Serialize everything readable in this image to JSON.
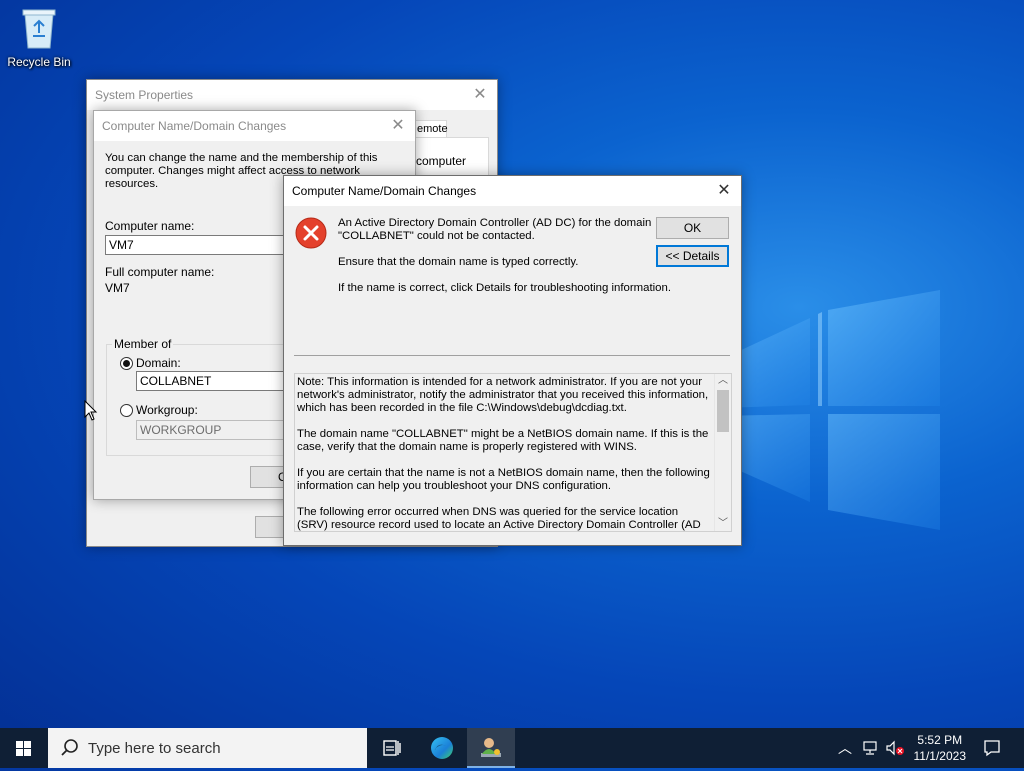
{
  "desktop": {
    "recycle_bin_label": "Recycle Bin"
  },
  "system_properties": {
    "title": "System Properties",
    "tab_remote_partial": "emote",
    "partial_text": "computer"
  },
  "name_changes": {
    "title": "Computer Name/Domain Changes",
    "description": "You can change the name and the membership of this computer. Changes might affect access to network resources.",
    "computer_name_label": "Computer name:",
    "computer_name_value": "VM7",
    "full_name_label": "Full computer name:",
    "full_name_value": "VM7",
    "member_of_label": "Member of",
    "domain_label": "Domain:",
    "domain_value": "COLLABNET",
    "workgroup_label": "Workgroup:",
    "workgroup_value": "WORKGROUP",
    "ok_partial": "O"
  },
  "error_dialog": {
    "title": "Computer Name/Domain Changes",
    "message_line1": "An Active Directory Domain Controller (AD DC) for the domain",
    "message_line2": "\"COLLABNET\" could not be contacted.",
    "message_ensure": "Ensure that the domain name is typed correctly.",
    "message_details": "If the name is correct, click Details for troubleshooting information.",
    "ok_label": "OK",
    "details_label": "<< Details",
    "details_paragraphs": [
      "Note: This information is intended for a network administrator.  If you are not your network's administrator, notify the administrator that you received this information, which has been recorded in the file C:\\Windows\\debug\\dcdiag.txt.",
      "The domain name \"COLLABNET\" might be a NetBIOS domain name.  If this is the case, verify that the domain name is properly registered with WINS.",
      "If you are certain that the name is not a NetBIOS domain name, then the following information can help you troubleshoot your DNS configuration.",
      "The following error occurred when DNS was queried for the service location (SRV) resource record used to locate an Active Directory Domain Controller (AD DC) for domain \"COLLABNET\":"
    ]
  },
  "taskbar": {
    "search_placeholder": "Type here to search",
    "time": "5:52 PM",
    "date": "11/1/2023"
  }
}
